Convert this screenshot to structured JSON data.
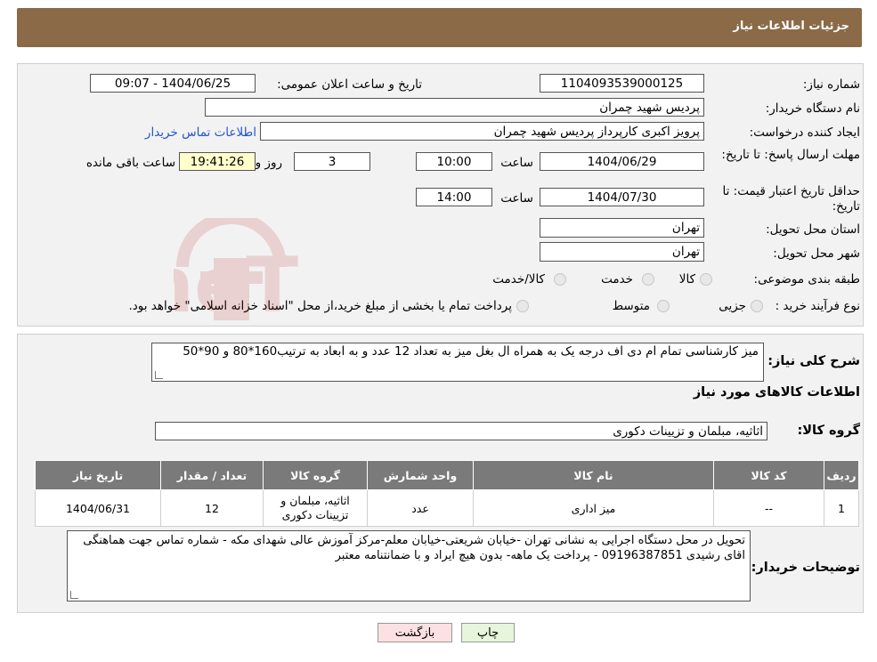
{
  "header": {
    "title": "جزئیات اطلاعات نیاز"
  },
  "fields": {
    "need_number_label": "شماره نیاز:",
    "need_number": "1104093539000125",
    "announce_label": "تاریخ و ساعت اعلان عمومی:",
    "announce_value": "1404/06/25 - 09:07",
    "buyer_label": "نام دستگاه خریدار:",
    "buyer_value": "پردیس شهید چمران",
    "creator_label": "ایجاد کننده درخواست:",
    "creator_value": "پرویز اکبری کارپرداز پردیس شهید چمران",
    "contact_link": "اطلاعات تماس خریدار",
    "deadline_label": "مهلت ارسال پاسخ: تا تاریخ:",
    "deadline_date": "1404/06/29",
    "time_label": "ساعت",
    "deadline_time": "10:00",
    "days_value": "3",
    "days_label": "روز و",
    "remaining_time": "19:41:26",
    "remaining_label": "ساعت باقی مانده",
    "validity_label": "حداقل تاریخ اعتبار قیمت: تا تاریخ:",
    "validity_date": "1404/07/30",
    "validity_time": "14:00",
    "province_label": "استان محل تحویل:",
    "province_value": "تهران",
    "city_label": "شهر محل تحویل:",
    "city_value": "تهران",
    "category_label": "طبقه بندی موضوعی:",
    "category_options": [
      "کالا",
      "خدمت",
      "کالا/خدمت"
    ],
    "process_label": "نوع فرآیند خرید :",
    "process_options": [
      "جزیی",
      "متوسط"
    ],
    "process_note": "پرداخت تمام یا بخشی از مبلغ خرید،از محل \"اسناد خزانه اسلامی\" خواهد بود."
  },
  "summary": {
    "label": "شرح کلی نیاز:",
    "text": "میز کارشناسی تمام ام دی اف درجه یک به همراه ال بغل میز به تعداد 12 عدد و به ابعاد به ترتیب160*80 و 90*50",
    "goods_info_title": "اطلاعات کالاهای مورد نیاز",
    "goods_group_label": "گروه کالا:",
    "goods_group_value": "اثاثیه، مبلمان و تزیینات دکوری"
  },
  "table": {
    "headers": [
      "ردیف",
      "کد کالا",
      "نام کالا",
      "واحد شمارش",
      "گروه کالا",
      "تعداد / مقدار",
      "تاریخ نیاز"
    ],
    "rows": [
      [
        "1",
        "--",
        "میز اداری",
        "عدد",
        "اثاثیه، مبلمان و تزیینات دکوری",
        "12",
        "1404/06/31"
      ]
    ]
  },
  "buyer_notes": {
    "label": "توضیحات خریدار:",
    "text": "تحویل در محل دستگاه اجرایی به نشانی تهران -خیابان شریعتی-خیابان معلم-مرکز آموزش عالی شهدای مکه - شماره تماس جهت هماهنگی اقای رشیدی  09196387851 - پرداخت یک ماهه- بدون هیچ ایراد و با ضمانتنامه معتبر"
  },
  "buttons": {
    "print": "چاپ",
    "back": "بازگشت"
  },
  "watermark": {
    "text": "AriaTender.neT"
  },
  "colors": {
    "header_bg": "#8b6a47",
    "table_header": "#7a7a7a",
    "print_btn": "#e6f5dc",
    "back_btn": "#fde1e1"
  }
}
